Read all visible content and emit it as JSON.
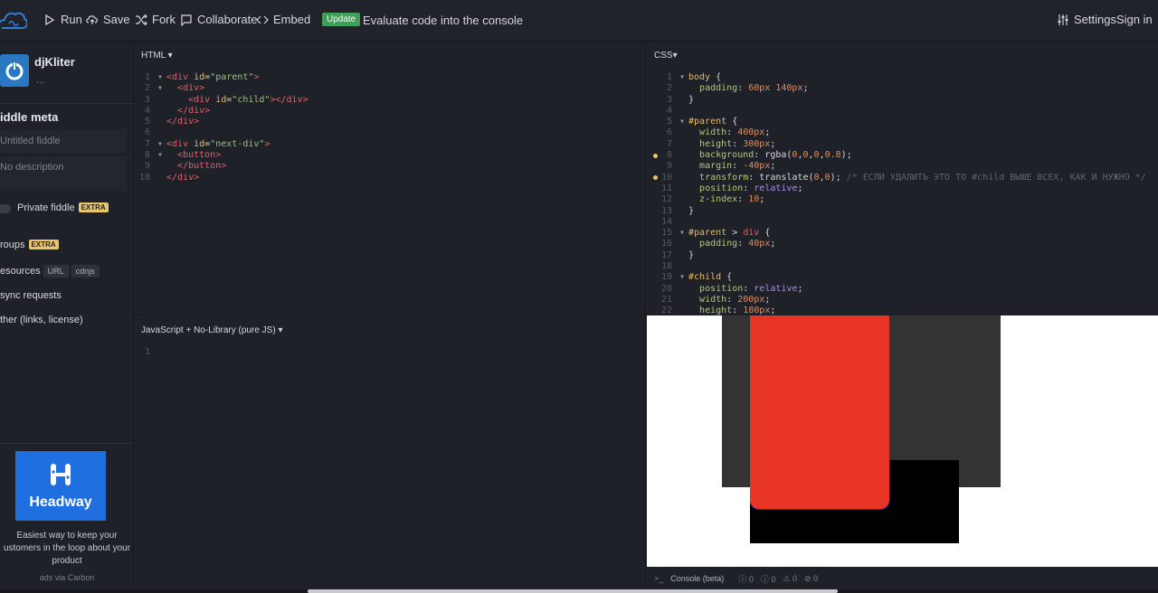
{
  "toolbar": {
    "run": "Run",
    "save": "Save",
    "fork": "Fork",
    "collaborate": "Collaborate",
    "embed": "Embed",
    "update_badge": "Update",
    "update_text": "Evaluate code into the console",
    "settings": "Settings",
    "sign_in": "Sign in"
  },
  "sidebar": {
    "user_name": "djKliter",
    "user_sub": "...",
    "meta_title": "iddle meta",
    "title_placeholder": "Untitled fiddle",
    "desc_placeholder": "No description",
    "private_label": "Private fiddle",
    "extra": "EXTRA",
    "groups": "roups",
    "resources": "esources",
    "chip_url": "URL",
    "chip_cdnjs": "cdnjs",
    "async": "sync requests",
    "other": "ther (links, license)",
    "ad_brand": "Headway",
    "ad_text_1": "Easiest way to keep your",
    "ad_text_2": "ustomers in the loop about your",
    "ad_text_3": "product",
    "ad_via": "ads via Carbon"
  },
  "panels": {
    "html_title": "HTML",
    "css_title": "CSS",
    "js_title": "JavaScript + No-Library (pure JS)"
  },
  "console": {
    "label": "Console (beta)",
    "count_info": "0",
    "count_log": "0",
    "count_warn": "0",
    "count_error": "0"
  },
  "colors": {
    "accent_update": "#3f9e57",
    "parent_bg": "#333333",
    "child_red": "#e83424",
    "black_div": "#000000",
    "ad_blue": "#1f6fe0"
  }
}
